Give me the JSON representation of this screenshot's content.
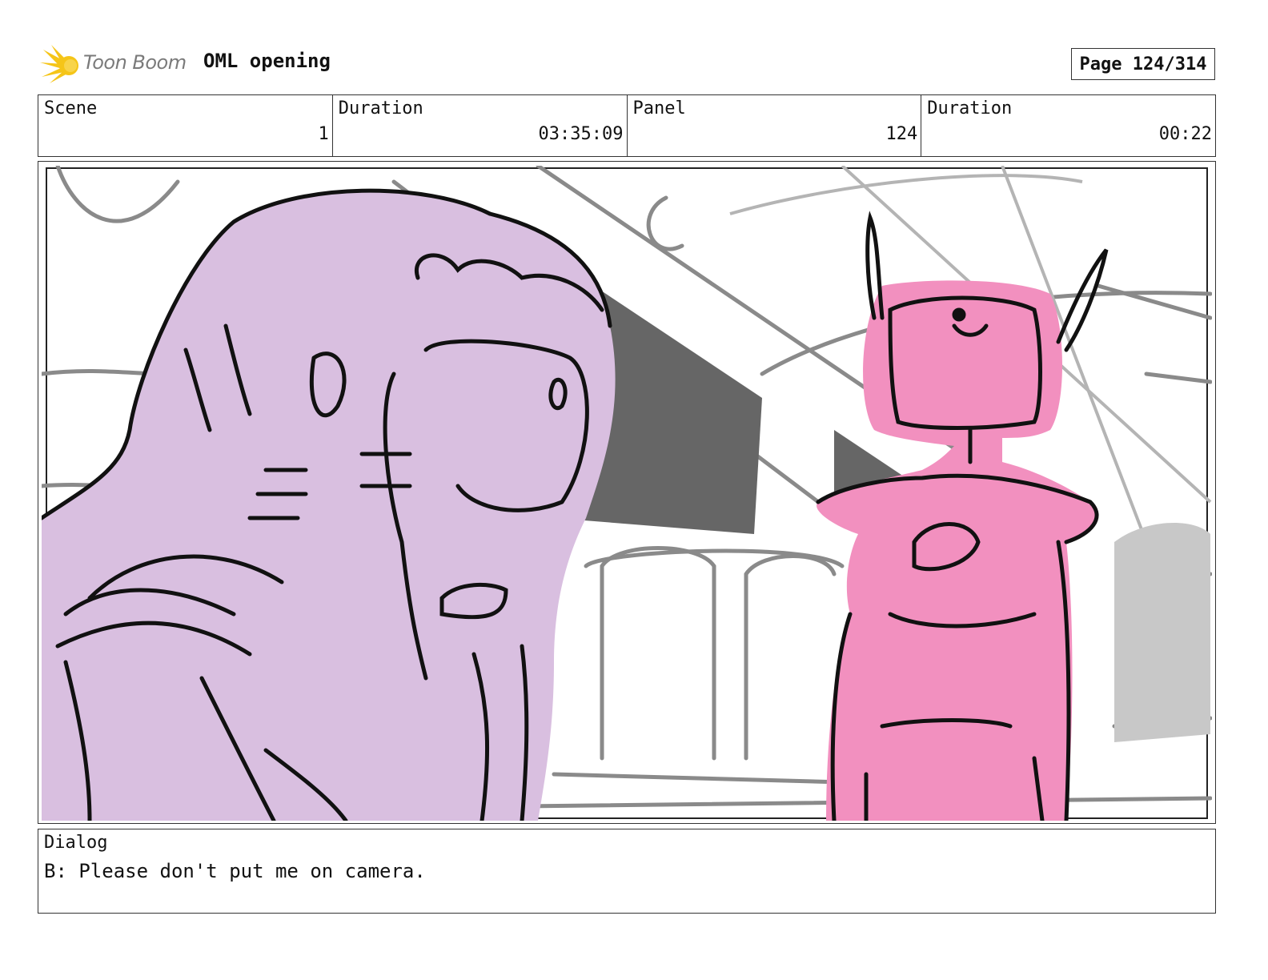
{
  "header": {
    "logo_text": "Toon Boom",
    "project_title": "OML opening",
    "page_label": "Page 124/314"
  },
  "info": {
    "scene_label": "Scene",
    "scene_value": "1",
    "scene_duration_label": "Duration",
    "scene_duration_value": "03:35:09",
    "panel_label": "Panel",
    "panel_value": "124",
    "panel_duration_label": "Duration",
    "panel_duration_value": "00:22"
  },
  "dialog": {
    "label": "Dialog",
    "text": "B: Please don't put me on camera."
  },
  "colors": {
    "character_left_fill": "#d9bfe0",
    "robot_fill": "#f290bf",
    "background_lines": "#8a8a8a",
    "shadow": "#666666",
    "logo_burst": "#f5c518"
  }
}
